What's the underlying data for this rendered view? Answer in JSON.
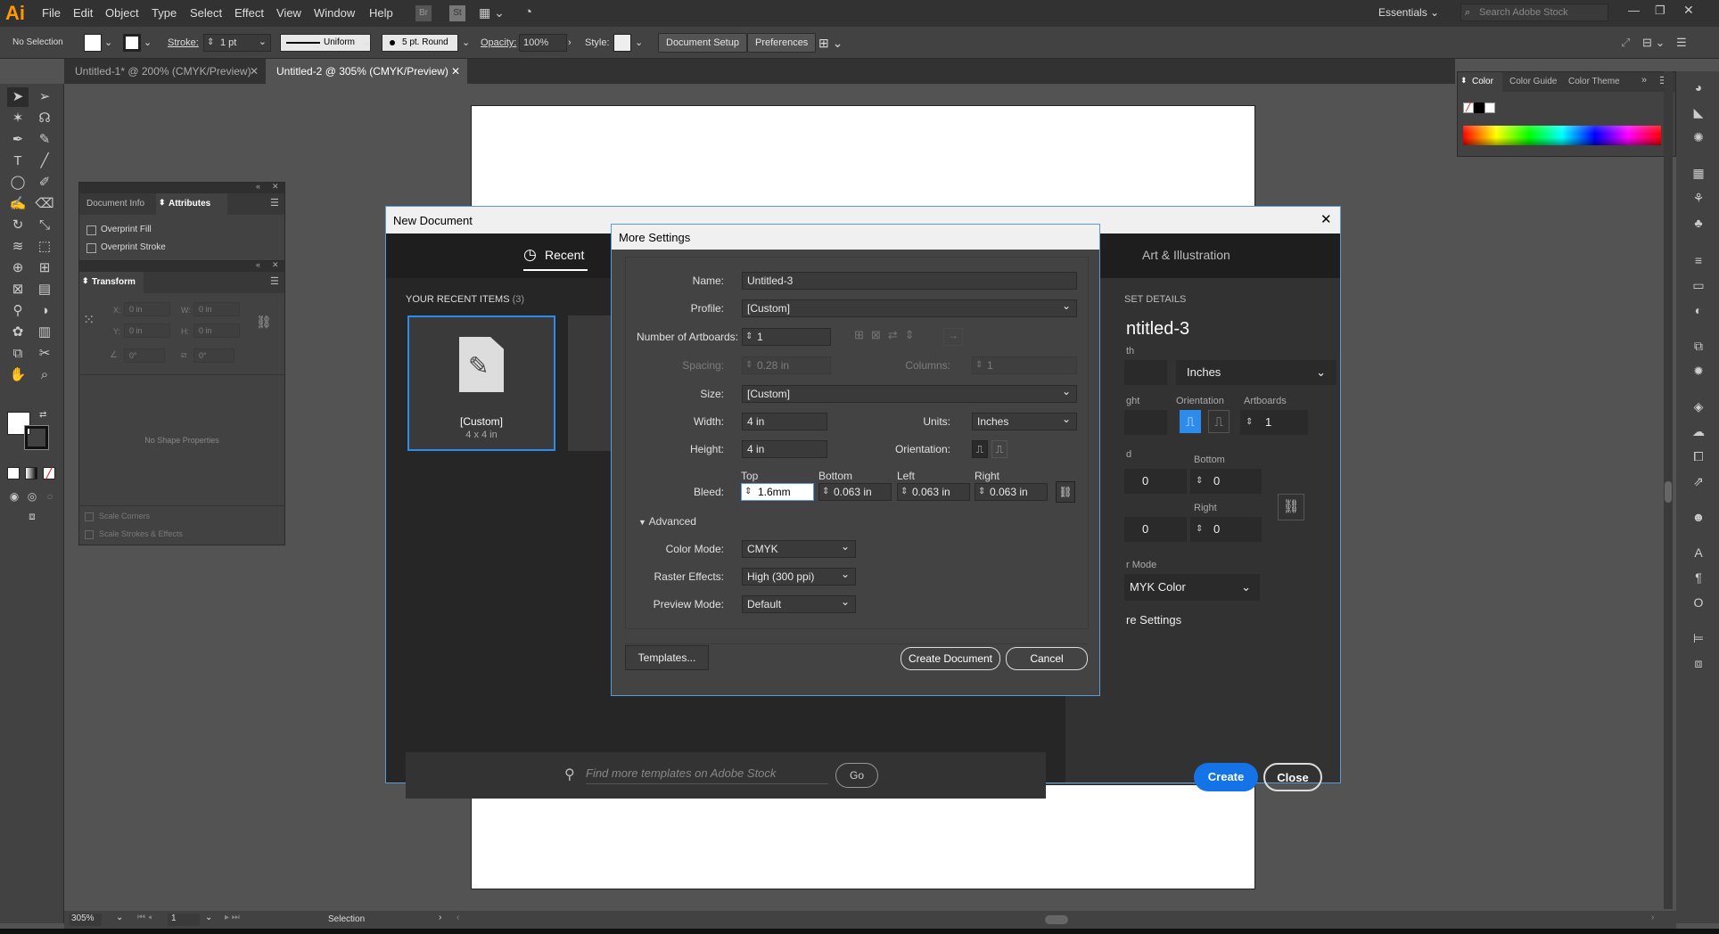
{
  "app": {
    "logo": "Ai"
  },
  "menu": [
    "File",
    "Edit",
    "Object",
    "Type",
    "Select",
    "Effect",
    "View",
    "Window",
    "Help"
  ],
  "workspace": {
    "label": "Essentials",
    "search_placeholder": "Search Adobe Stock"
  },
  "control_bar": {
    "selection": "No Selection",
    "stroke_label": "Stroke:",
    "stroke_value": "1 pt",
    "stroke_profile": "Uniform",
    "brush": "5 pt. Round",
    "opacity_label": "Opacity:",
    "opacity_value": "100%",
    "style_label": "Style:",
    "document_setup": "Document Setup",
    "preferences": "Preferences"
  },
  "tabs": [
    {
      "label": "Untitled-1* @ 200% (CMYK/Preview)",
      "active": false
    },
    {
      "label": "Untitled-2 @ 305% (CMYK/Preview)",
      "active": true
    }
  ],
  "attributes_panel": {
    "tabs": [
      "Document Info",
      "Attributes"
    ],
    "overprint_fill": "Overprint Fill",
    "overprint_stroke": "Overprint Stroke"
  },
  "transform_panel": {
    "title": "Transform",
    "x_label": "X:",
    "x_value": "0 in",
    "y_label": "Y:",
    "y_value": "0 in",
    "w_label": "W:",
    "w_value": "0 in",
    "h_label": "H:",
    "h_value": "0 in",
    "angle_value": "0°",
    "shear_value": "0°",
    "no_shape": "No Shape Properties",
    "scale_corners": "Scale Corners",
    "scale_strokes": "Scale Strokes & Effects"
  },
  "color_panel": {
    "tabs": [
      "Color",
      "Color Guide",
      "Color Theme"
    ]
  },
  "new_document": {
    "title": "New Document",
    "recent_tab": "Recent",
    "art_tab": "Art & Illustration",
    "recent_header": "YOUR RECENT ITEMS",
    "recent_count": "(3)",
    "recent_item_name": "[Custom]",
    "recent_item_size": "4 x 4 in",
    "stock_placeholder": "Find more templates on Adobe Stock",
    "go": "Go",
    "preset_details": "SET DETAILS",
    "preset_name": "ntitled-3",
    "width_label": "th",
    "units": "Inches",
    "height_label": "ght",
    "orientation_label": "Orientation",
    "artboards_label": "Artboards",
    "artboards_value": "1",
    "bleed_label": "d",
    "bottom_label": "Bottom",
    "right_label": "Right",
    "bleed_top": "0",
    "bleed_bottom": "0",
    "bleed_left": "0",
    "bleed_right": "0",
    "color_mode_label": "r Mode",
    "color_mode": "MYK Color",
    "more_settings": "re Settings",
    "create": "Create",
    "close": "Close"
  },
  "more_settings": {
    "title": "More Settings",
    "name_label": "Name:",
    "name_value": "Untitled-3",
    "profile_label": "Profile:",
    "profile_value": "[Custom]",
    "artboards_label": "Number of Artboards:",
    "artboards_value": "1",
    "spacing_label": "Spacing:",
    "spacing_value": "0.28 in",
    "columns_label": "Columns:",
    "columns_value": "1",
    "size_label": "Size:",
    "size_value": "[Custom]",
    "width_label": "Width:",
    "width_value": "4 in",
    "units_label": "Units:",
    "units_value": "Inches",
    "height_label": "Height:",
    "height_value": "4 in",
    "orientation_label": "Orientation:",
    "bleed_label": "Bleed:",
    "top_label": "Top",
    "top_value": "1.6mm",
    "bottom_label": "Bottom",
    "bottom_value": "0.063 in",
    "left_label": "Left",
    "left_value": "0.063 in",
    "right_label": "Right",
    "right_value": "0.063 in",
    "advanced": "Advanced",
    "color_mode_label": "Color Mode:",
    "color_mode_value": "CMYK",
    "raster_label": "Raster Effects:",
    "raster_value": "High (300 ppi)",
    "preview_label": "Preview Mode:",
    "preview_value": "Default",
    "templates": "Templates...",
    "create_document": "Create Document",
    "cancel": "Cancel"
  },
  "status": {
    "zoom": "305%",
    "page": "1",
    "tool": "Selection"
  }
}
